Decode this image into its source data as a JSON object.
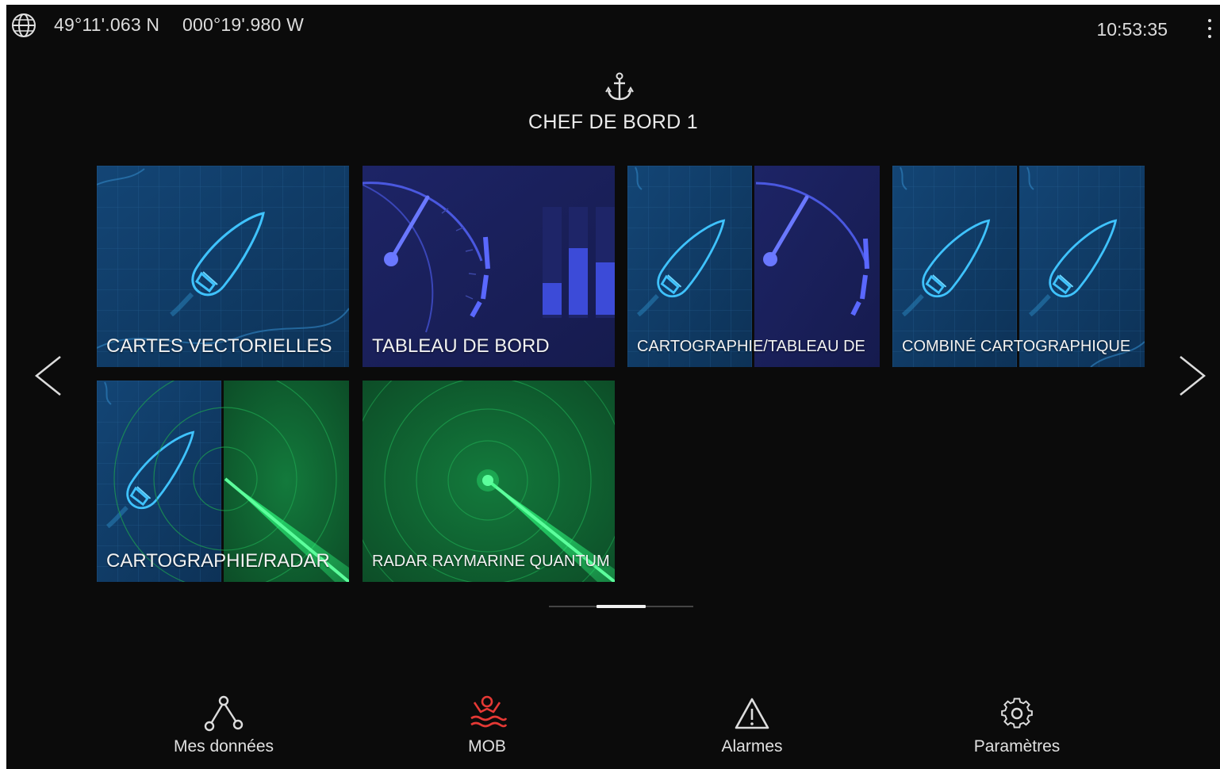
{
  "status_bar": {
    "latitude": "49°11'.063 N",
    "longitude": "000°19'.980 W",
    "time": "10:53:35"
  },
  "profile": {
    "name": "CHEF DE BORD 1",
    "icon": "anchor-icon"
  },
  "apps": [
    {
      "label": "CARTES VECTORIELLES",
      "type": "chart"
    },
    {
      "label": "TABLEAU DE BORD",
      "type": "dashboard"
    },
    {
      "label": "CARTOGRAPHIE/TABLEAU DE",
      "type": "chart-dashboard"
    },
    {
      "label": "COMBINÉ CARTOGRAPHIQUE",
      "type": "chart-chart"
    },
    {
      "label": "CARTOGRAPHIE/RADAR",
      "type": "chart-radar"
    },
    {
      "label": "RADAR RAYMARINE QUANTUM",
      "type": "radar"
    }
  ],
  "pager": {
    "pages": 3,
    "current": 2
  },
  "bottom_bar": {
    "my_data": "Mes données",
    "mob": "MOB",
    "alarms": "Alarmes",
    "settings": "Paramètres"
  },
  "colors": {
    "background": "#0b0b0b",
    "chart_tile": "#123c63",
    "dashboard_tile": "#1a1f5c",
    "radar_tile": "#0f5a2e",
    "mob_red": "#e53935"
  }
}
